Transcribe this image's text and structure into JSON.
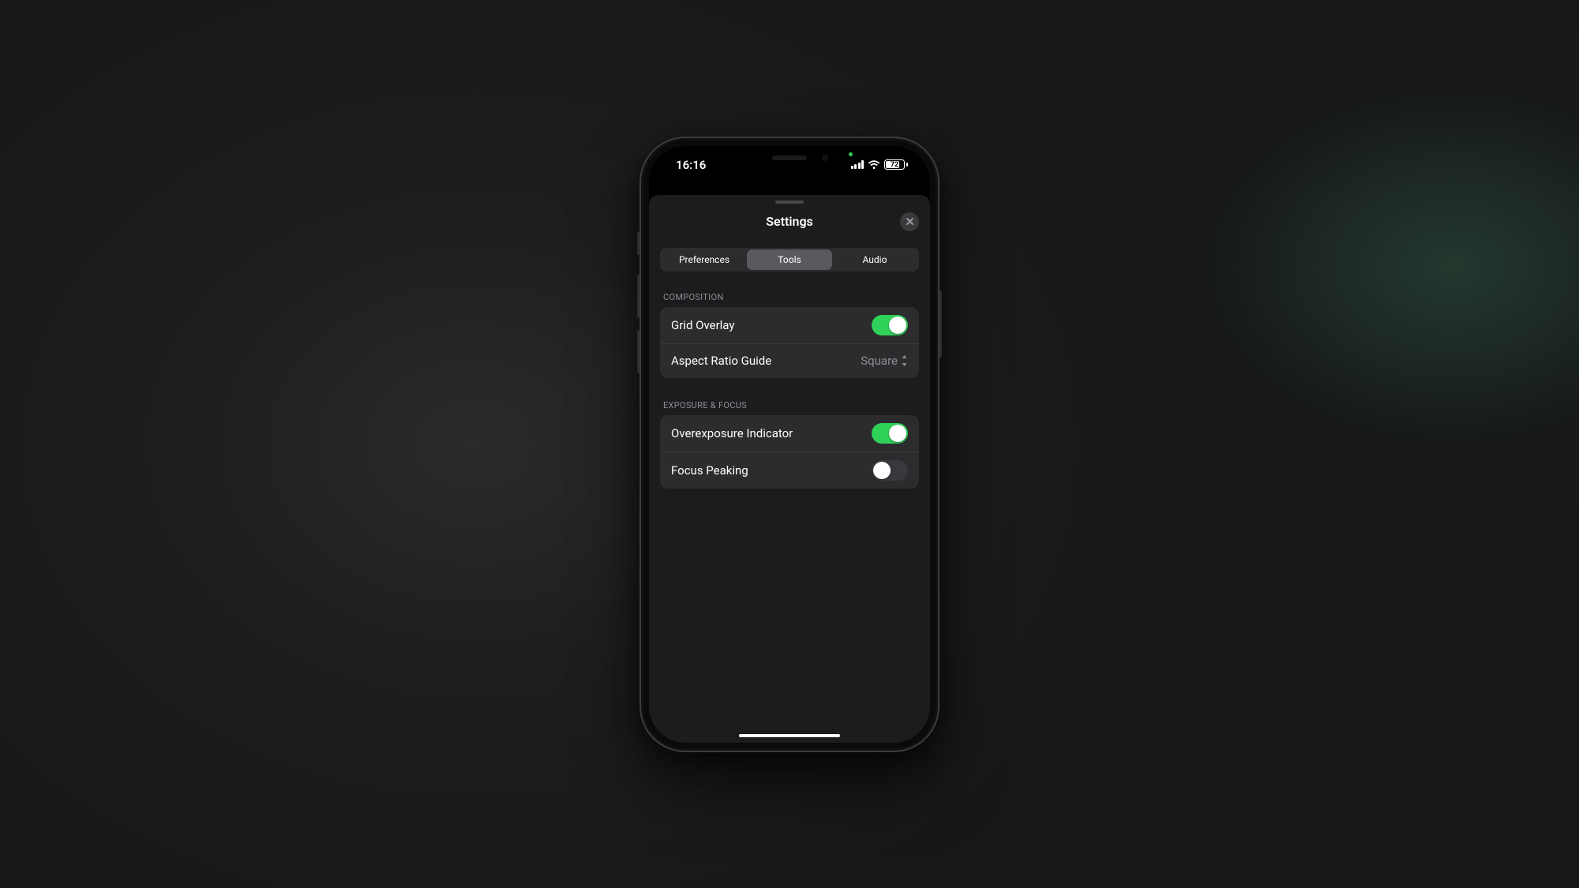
{
  "status": {
    "time": "16:16",
    "battery_pct": "72"
  },
  "sheet": {
    "title": "Settings",
    "tabs": {
      "preferences": "Preferences",
      "tools": "Tools",
      "audio": "Audio"
    },
    "sections": {
      "composition": {
        "header": "COMPOSITION",
        "grid_overlay": {
          "label": "Grid Overlay",
          "on": true
        },
        "aspect_ratio": {
          "label": "Aspect Ratio Guide",
          "value": "Square"
        }
      },
      "exposure_focus": {
        "header": "EXPOSURE & FOCUS",
        "overexposure": {
          "label": "Overexposure Indicator",
          "on": true
        },
        "focus_peaking": {
          "label": "Focus Peaking",
          "on": false
        }
      }
    }
  }
}
